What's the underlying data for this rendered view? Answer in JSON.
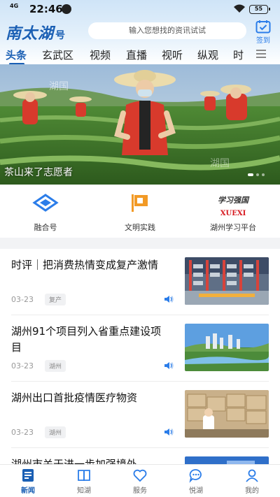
{
  "status_bar": {
    "network": "4G",
    "time": "22:46",
    "battery": "55"
  },
  "header": {
    "logo_main": "南太湖",
    "logo_sub": "号",
    "search_placeholder": "输入您想找的资讯试试",
    "checkin_label": "签到"
  },
  "tabs": [
    "头条",
    "玄武区",
    "视频",
    "直播",
    "视听",
    "纵观",
    "时"
  ],
  "active_tab": 0,
  "banner": {
    "caption": "茶山来了志愿者",
    "watermark": "湖国"
  },
  "quick_entries": [
    {
      "label": "融合号",
      "icon": "diamond-logo-icon"
    },
    {
      "label": "文明实践",
      "icon": "flag-icon"
    },
    {
      "label": "湖州学习平台",
      "icon": "xuexi-logo",
      "logo_text": "学习强国",
      "logo_sub": "XUEXI"
    }
  ],
  "news": [
    {
      "title": "时评｜把消费热情变成复产激情",
      "date": "03-23",
      "tag": "复产",
      "thumb": "warehouse"
    },
    {
      "title": "湖州91个项目列入省重点建设项目",
      "date": "03-23",
      "tag": "湖州",
      "thumb": "city"
    },
    {
      "title": "湖州出口首批疫情医疗物资",
      "date": "03-23",
      "tag": "湖州",
      "thumb": "boxes"
    },
    {
      "title": "湖州市关于进一步加强境外",
      "date": "",
      "tag": "",
      "thumb": "blue"
    }
  ],
  "bottom_nav": [
    {
      "label": "新闻",
      "icon": "news-icon",
      "active": true
    },
    {
      "label": "知湖",
      "icon": "book-icon",
      "active": false
    },
    {
      "label": "服务",
      "icon": "heart-icon",
      "active": false
    },
    {
      "label": "悦湖",
      "icon": "chat-bubble-icon",
      "active": false
    },
    {
      "label": "我的",
      "icon": "person-icon",
      "active": false
    }
  ],
  "colors": {
    "brand": "#1a5fb4",
    "accent_blue": "#2b7de9",
    "xuexi_red": "#d7191f",
    "flag_orange": "#f29a26"
  }
}
